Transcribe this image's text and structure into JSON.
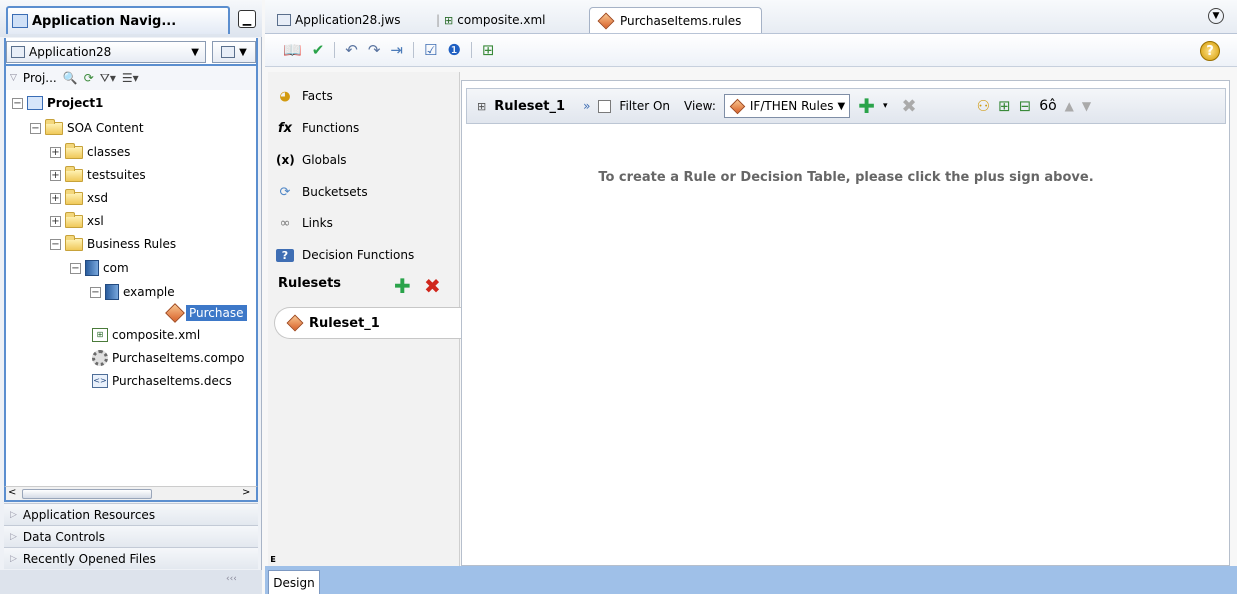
{
  "left_panel": {
    "title": "Application Navig...",
    "application": "Application28",
    "projects_label": "Proj...",
    "tree": [
      {
        "label": "Project1",
        "bold": true
      },
      {
        "label": "SOA Content"
      },
      {
        "label": "classes"
      },
      {
        "label": "testsuites"
      },
      {
        "label": "xsd"
      },
      {
        "label": "xsl"
      },
      {
        "label": "Business Rules"
      },
      {
        "label": "com"
      },
      {
        "label": "example"
      },
      {
        "label": "Purchase"
      },
      {
        "label": "composite.xml"
      },
      {
        "label": "PurchaseItems.compo"
      },
      {
        "label": "PurchaseItems.decs"
      }
    ],
    "accordion": [
      "Application Resources",
      "Data Controls",
      "Recently Opened Files"
    ]
  },
  "tabs": [
    {
      "label": "Application28.jws"
    },
    {
      "label": "composite.xml"
    },
    {
      "label": "PurchaseItems.rules",
      "active": true
    }
  ],
  "rules_nav": {
    "items": [
      {
        "label": "Facts",
        "icon": "facts-icon"
      },
      {
        "label": "Functions",
        "icon": "functions-icon"
      },
      {
        "label": "Globals",
        "icon": "globals-icon"
      },
      {
        "label": "Bucketsets",
        "icon": "bucketsets-icon"
      },
      {
        "label": "Links",
        "icon": "links-icon"
      },
      {
        "label": "Decision Functions",
        "icon": "decision-functions-icon"
      }
    ],
    "rulesets_label": "Rulesets",
    "ruleset": "Ruleset_1"
  },
  "editor": {
    "ruleset_title": "Ruleset_1",
    "filter_label": "Filter On",
    "view_label": "View:",
    "view_value": "IF/THEN Rules",
    "hint": "To create a Rule or Decision Table, please click the plus sign above."
  },
  "bottom": {
    "design_tab": "Design"
  }
}
